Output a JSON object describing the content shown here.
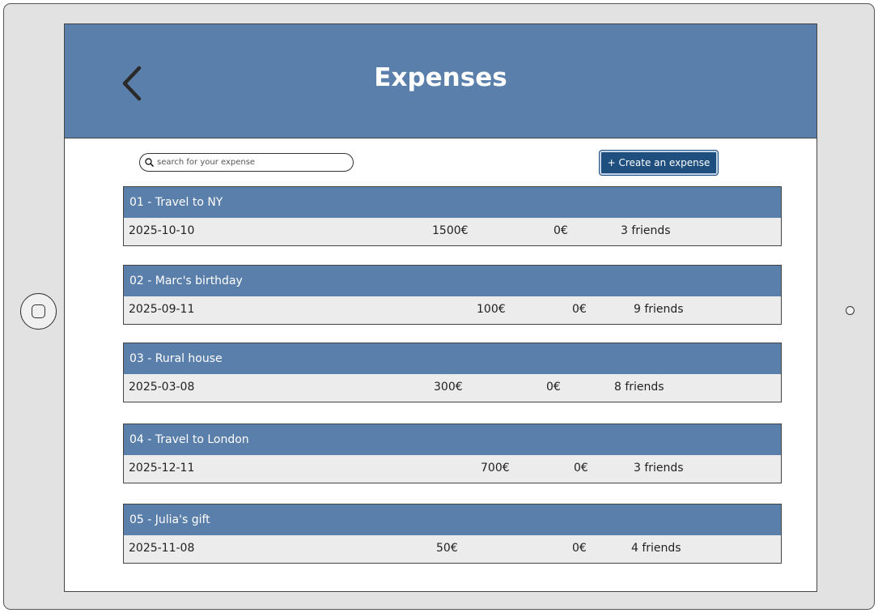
{
  "header": {
    "title": "Expenses"
  },
  "search": {
    "placeholder": "search for your expense",
    "value": ""
  },
  "toolbar": {
    "create_label": "+ Create an expense"
  },
  "expenses": [
    {
      "title": "01 - Travel to NY",
      "date": "2025-10-10",
      "amount": "1500€",
      "balance": "0€",
      "friends": "3 friends"
    },
    {
      "title": "02 - Marc's birthday",
      "date": "2025-09-11",
      "amount": "100€",
      "balance": "0€",
      "friends": "9 friends"
    },
    {
      "title": "03 - Rural house",
      "date": "2025-03-08",
      "amount": "300€",
      "balance": "0€",
      "friends": "8 friends"
    },
    {
      "title": "04 - Travel to London",
      "date": "2025-12-11",
      "amount": "700€",
      "balance": "0€",
      "friends": "3 friends"
    },
    {
      "title": "05 - Julia's gift",
      "date": "2025-11-08",
      "amount": "50€",
      "balance": "0€",
      "friends": "4 friends"
    }
  ],
  "colors": {
    "header": "#5a7fab",
    "button": "#1f4f7f",
    "row_body": "#ececec",
    "device": "#e2e2e2"
  },
  "icons": {
    "back": "chevron-left-icon",
    "search": "search-icon",
    "home": "home-button-icon",
    "camera": "camera-icon"
  }
}
